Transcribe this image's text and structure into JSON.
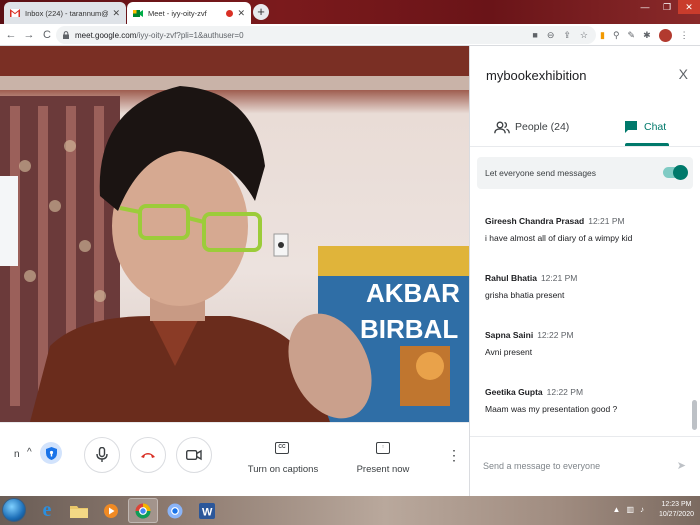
{
  "browser": {
    "tabs": [
      {
        "title": "Inbox (224) - tarannum@theindi",
        "active": false
      },
      {
        "title": "Meet - iyy-oity-zvf",
        "active": true
      }
    ],
    "new_tab_symbol": "+",
    "back_symbol": "←",
    "forward_symbol": "→",
    "reload_symbol": "C",
    "url_host": "meet.google.com",
    "url_path": "/iyy-oity-zvf?pli=1&authuser=0",
    "window_min": "—",
    "window_max": "❐",
    "window_close": "✕"
  },
  "controls": {
    "captions_label": "Turn on captions",
    "present_label": "Present now",
    "captions_icon_text": "CC",
    "truncated_name": "n",
    "chevron": "^"
  },
  "panel": {
    "title": "mybookexhibition",
    "close_symbol": "X",
    "people_tab": "People (24)",
    "chat_tab": "Chat",
    "setting_label": "Let everyone send messages",
    "setting_enabled": true,
    "messages": [
      {
        "sender": "Gireesh Chandra Prasad",
        "time": "12:21 PM",
        "text": "i have almost all of diary of a wimpy kid"
      },
      {
        "sender": "Rahul Bhatia",
        "time": "12:21 PM",
        "text": "grisha bhatia present"
      },
      {
        "sender": "Sapna Saini",
        "time": "12:22 PM",
        "text": "Avni present"
      },
      {
        "sender": "Geetika Gupta",
        "time": "12:22 PM",
        "text": "Maam was my presentation good ?"
      }
    ],
    "compose_placeholder": "Send a message to everyone",
    "send_symbol": "➤"
  },
  "video_backdrop": {
    "book_line1": "AKBAR",
    "book_line2": "BIRBAL"
  },
  "taskbar": {
    "time": "12:23 PM",
    "date": "10/27/2020"
  },
  "colors": {
    "accent": "#00796b",
    "hangup": "#d93025",
    "taskbar_start": "#1d6fb8"
  }
}
